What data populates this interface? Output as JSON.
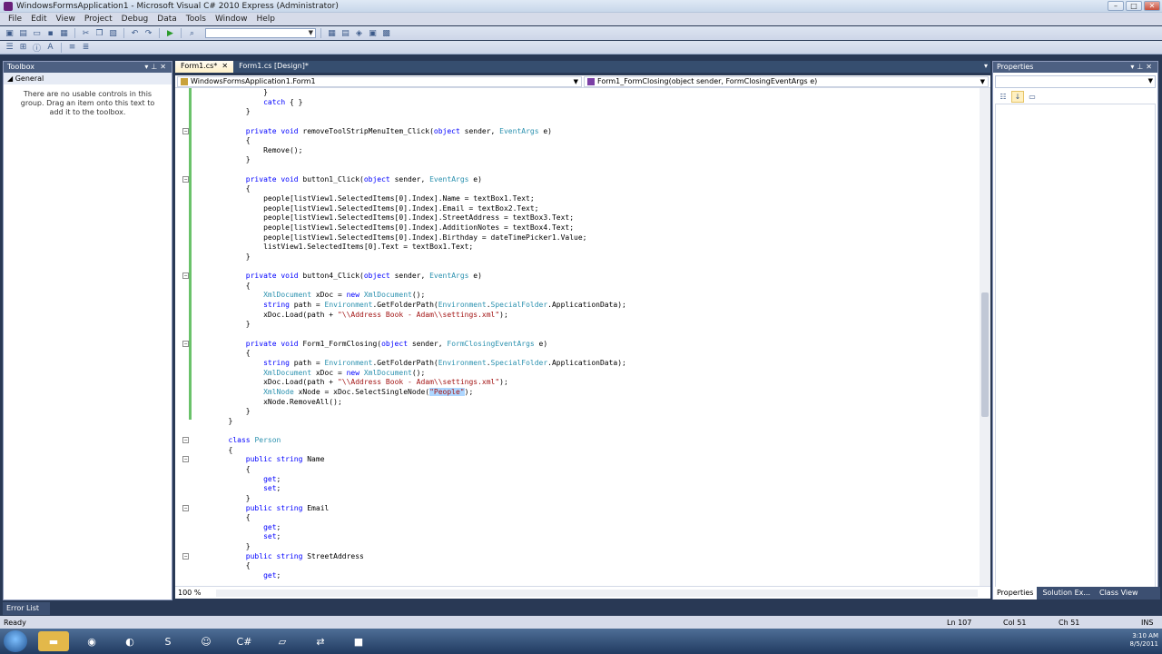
{
  "window": {
    "title": "WindowsFormsApplication1 - Microsoft Visual C# 2010 Express (Administrator)"
  },
  "menu": [
    "File",
    "Edit",
    "View",
    "Project",
    "Debug",
    "Data",
    "Tools",
    "Window",
    "Help"
  ],
  "toolbox": {
    "title": "Toolbox",
    "group": "General",
    "empty_message": "There are no usable controls in this group. Drag an item onto this text to add it to the toolbox."
  },
  "properties": {
    "title": "Properties"
  },
  "tabs": {
    "active": "Form1.cs*",
    "inactive": "Form1.cs [Design]*"
  },
  "nav": {
    "class": "WindowsFormsApplication1.Form1",
    "member": "Form1_FormClosing(object sender, FormClosingEventArgs e)"
  },
  "zoom": "100 %",
  "right_tabs": [
    "Properties",
    "Solution Ex...",
    "Class View"
  ],
  "bottom_tab": "Error List",
  "status": {
    "ready": "Ready",
    "ln": "Ln 107",
    "col": "Col 51",
    "ch": "Ch 51",
    "ins": "INS"
  },
  "clock": {
    "time": "3:10 AM",
    "date": "8/5/2011"
  }
}
